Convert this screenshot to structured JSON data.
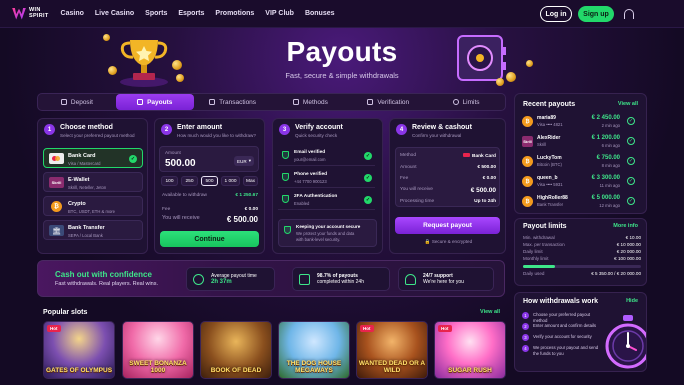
{
  "nav": {
    "logo_line1": "WIN",
    "logo_line2": "SPIRIT",
    "links": [
      "Casino",
      "Live Casino",
      "Sports",
      "Esports",
      "Promotions",
      "VIP Club",
      "Bonuses"
    ],
    "login": "Log in",
    "signup": "Sign up",
    "support_icon": "headset-icon"
  },
  "hero": {
    "title": "Payouts",
    "subtitle": "Fast, secure & simple withdrawals"
  },
  "tabs": [
    "Deposit",
    "Payouts",
    "Transactions",
    "Methods",
    "Verification",
    "Limits"
  ],
  "step1": {
    "num": "1",
    "title": "Choose method",
    "sub": "Select your preferred payout method",
    "methods": [
      {
        "name": "Bank Card",
        "desc": "Visa / Mastercard",
        "color": "#e8e1f3"
      },
      {
        "name": "E-Wallet",
        "desc": "Skrill, Neteller, Jeton",
        "color": "#8a2b6e"
      },
      {
        "name": "Crypto",
        "desc": "BTC, USDT, ETH & more",
        "color": "#f39a1e"
      },
      {
        "name": "Bank Transfer",
        "desc": "SEPA / Local Bank",
        "color": "#3b4a78"
      }
    ]
  },
  "step2": {
    "num": "2",
    "title": "Enter amount",
    "sub": "How much would you like to withdraw?",
    "amount_label": "Amount",
    "amount": "500.00",
    "currency": "EUR",
    "chips": [
      "100",
      "250",
      "500",
      "1 000",
      "Max"
    ],
    "available_label": "Available to withdraw",
    "available": "€ 1 250.67",
    "fee_label": "Fee",
    "fee": "€ 0.00",
    "receive_label": "You will receive",
    "receive": "€ 500.00",
    "continue": "Continue"
  },
  "step3": {
    "num": "3",
    "title": "Verify account",
    "sub": "Quick security check",
    "items": [
      {
        "name": "Email verified",
        "desc": "your@email.com"
      },
      {
        "name": "Phone verified",
        "desc": "+44 7700 900123"
      },
      {
        "name": "2FA Authentication",
        "desc": "Enabled"
      }
    ],
    "secure_title": "Keeping your account secure",
    "secure_desc1": "We protect your funds and data",
    "secure_desc2": "with bank-level security."
  },
  "step4": {
    "num": "4",
    "title": "Review & cashout",
    "sub": "Confirm your withdrawal",
    "rows": [
      {
        "label": "Method",
        "value": "Bank Card"
      },
      {
        "label": "Amount",
        "value": "€ 500.00"
      },
      {
        "label": "Fee",
        "value": "€ 0.00"
      },
      {
        "label": "You will receive",
        "value": "€ 500.00"
      },
      {
        "label": "Processing time",
        "value": "Up to 24h"
      }
    ],
    "request": "Request payout",
    "secure_note": "Secure & encrypted"
  },
  "recent": {
    "title": "Recent payouts",
    "view_all": "View all",
    "items": [
      {
        "name": "maria89",
        "meta": "Visa •••• 4821",
        "amount": "€ 2 450.00",
        "time": "2 min ago",
        "icon": "bitcoin-icon",
        "color": "#f39a1e"
      },
      {
        "name": "AlexRider",
        "meta": "Skrill",
        "amount": "€ 1 200.00",
        "time": "6 min ago",
        "icon": "skrill-icon",
        "color": "#8a2b6e"
      },
      {
        "name": "LuckyTom",
        "meta": "Bitcoin (BTC)",
        "amount": "€ 750.00",
        "time": "8 min ago",
        "icon": "bitcoin-icon",
        "color": "#f39a1e"
      },
      {
        "name": "queen_b",
        "meta": "Visa •••• 5931",
        "amount": "€ 3 300.00",
        "time": "11 min ago",
        "icon": "bitcoin-icon",
        "color": "#f39a1e"
      },
      {
        "name": "HighRoller88",
        "meta": "Bank Transfer",
        "amount": "€ 5 000.00",
        "time": "12 min ago",
        "icon": "bitcoin-icon",
        "color": "#f39a1e"
      }
    ]
  },
  "limits": {
    "title": "Payout limits",
    "more": "More info",
    "rows": [
      {
        "label": "Min. withdrawal",
        "value": "€ 10.00"
      },
      {
        "label": "Max. per transaction",
        "value": "€ 10 000.00"
      },
      {
        "label": "Daily limit",
        "value": "€ 20 000.00"
      },
      {
        "label": "Monthly limit",
        "value": "€ 100 000.00"
      }
    ],
    "daily_used_label": "Daily used",
    "daily_used": "€ 5 350.00 / € 20 000.00",
    "daily_used_fraction": 0.2675
  },
  "how": {
    "title": "How withdrawals work",
    "hide": "Hide",
    "steps": [
      "Choose your preferred payout method",
      "Enter amount and confirm details",
      "Verify your account for security",
      "We process your payout and send the funds to you"
    ]
  },
  "banner": {
    "title": "Cash out with confidence",
    "sub": "Fast withdrawals. Real players. Real wins.",
    "features": [
      {
        "line1": "Average payout time",
        "line2": "2h 37m"
      },
      {
        "line1": "98.7% of payouts",
        "line2": "completed within 24h"
      },
      {
        "line1": "24/7 support",
        "line2": "We're here for you"
      }
    ]
  },
  "slots": {
    "title": "Popular slots",
    "view_all": "View all",
    "items": [
      {
        "name": "GATES OF OLYMPUS",
        "hot": "Hot"
      },
      {
        "name": "SWEET BONANZA 1000",
        "hot": ""
      },
      {
        "name": "BOOK OF DEAD",
        "hot": ""
      },
      {
        "name": "THE DOG HOUSE MEGAWAYS",
        "hot": ""
      },
      {
        "name": "WANTED DEAD OR A WILD",
        "hot": "Hot"
      },
      {
        "name": "SUGAR RUSH",
        "hot": "Hot"
      }
    ]
  }
}
